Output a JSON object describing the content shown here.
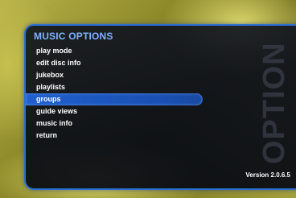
{
  "panel": {
    "title": "MUSIC OPTIONS",
    "watermark_text": "OPTIONS",
    "version": "Version 2.0.6.5"
  },
  "menu": {
    "items": [
      {
        "label": "play mode"
      },
      {
        "label": "edit disc info"
      },
      {
        "label": "jukebox"
      },
      {
        "label": "playlists"
      },
      {
        "label": "groups",
        "selected": true
      },
      {
        "label": "guide views"
      },
      {
        "label": "music info"
      },
      {
        "label": "return"
      }
    ]
  },
  "colors": {
    "accent": "#2a6fd0",
    "selection": "#1f5fcf",
    "title": "#7fb2ff",
    "text": "#ffffff"
  }
}
